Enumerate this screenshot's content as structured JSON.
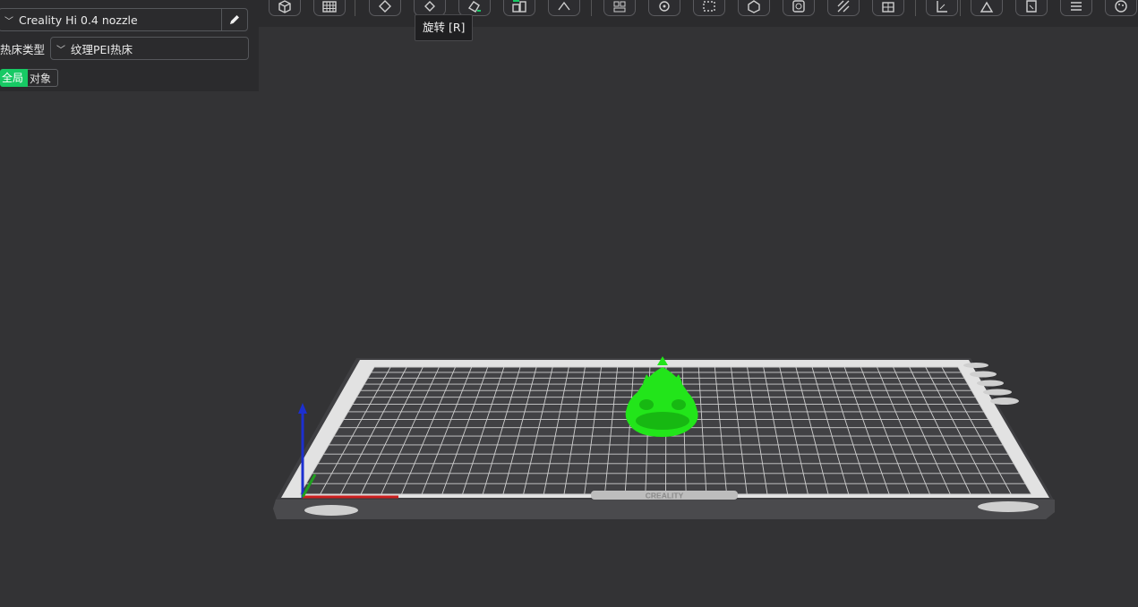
{
  "panel": {
    "printer": "Creality Hi 0.4 nozzle",
    "bed_type_label": "热床类型",
    "bed_type_value": "纹理PEI热床",
    "tabs": [
      {
        "label": "全局",
        "active": true
      },
      {
        "label": "对象",
        "active": false
      }
    ]
  },
  "toolbar": {
    "tooltip": "旋转 [R]",
    "icons": [
      "add-cube-icon",
      "arrange-grid-icon",
      "auto-orient-icon",
      "rotate-icon",
      "lay-on-face-icon",
      "split-objects-icon",
      "cut-icon",
      "measure-icon",
      "assembly-icon",
      "support-paint-icon",
      "seam-paint-icon",
      "color-paint-icon",
      "hollow-icon",
      "text-emboss-icon",
      "scale-icon",
      "variable-layer-icon",
      "layers-icon",
      "mmu-paint-icon"
    ]
  },
  "viewport": {
    "bed_brand": "CREALITY",
    "object_color": "#22e51a",
    "axis_colors": {
      "x": "#cc1f1f",
      "y": "#1fa01f",
      "z": "#1c2fd0"
    }
  }
}
